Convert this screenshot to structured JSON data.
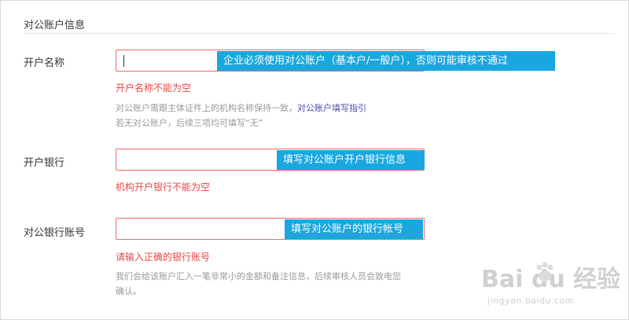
{
  "section": {
    "title": "对公账户信息"
  },
  "fields": [
    {
      "label": "开户名称",
      "tooltip": "企业必须使用对公账户（基本户/一般户），否则可能审核不通过",
      "error": "开户名称不能为空",
      "help_line1_prefix": "对公账户需跟主体证件上的机构名称保持一致，",
      "help_link": "对公账户填写指引",
      "help_line2": "若无对公账户，后续三项均可填写“无”"
    },
    {
      "label": "开户银行",
      "tooltip": "填写对公账户开户银行信息",
      "error": "机构开户银行不能为空"
    },
    {
      "label": "对公银行账号",
      "tooltip": "填写对公账户的银行帐号",
      "error": "请输入正确的银行账号",
      "help_line1": "我们会给该账户汇入一笔非常小的金额和备注信息，后续审核人员会致电您",
      "help_line2": "确认。"
    }
  ],
  "watermark": {
    "logo_text": "Bai du 经验",
    "url": "jingyan.baidu.com"
  },
  "colors": {
    "tooltip_bg": "#1aa7e0",
    "error_text": "#e94646",
    "input_border": "#f06b6b",
    "link": "#4a4ab0"
  }
}
